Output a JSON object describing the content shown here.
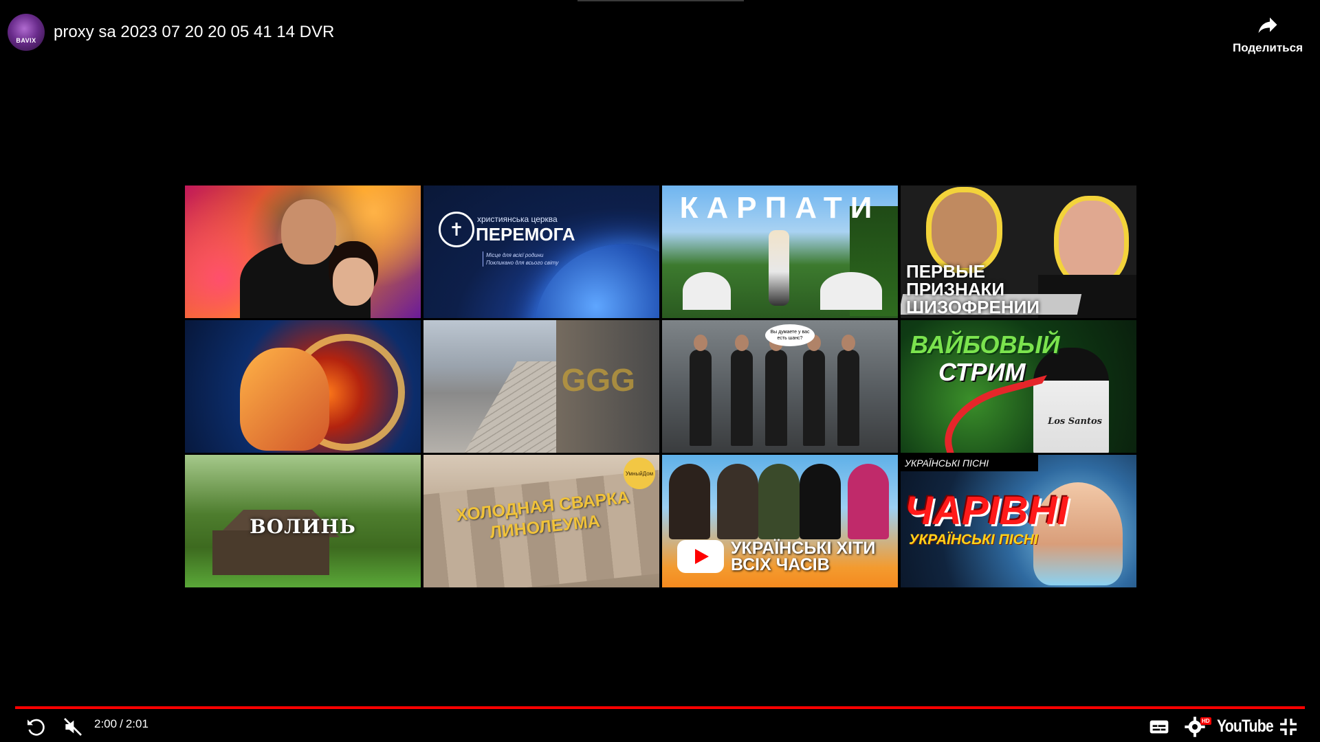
{
  "header": {
    "channel_avatar_text": "BAVIX",
    "video_title": "proxy sa 2023 07 20 20 05 41 14 DVR",
    "share_label": "Поделиться"
  },
  "thumbnails": [
    {
      "name": "thumb-action-movie"
    },
    {
      "name": "thumb-peremoga",
      "small": "християнська церква",
      "title": "ПЕРЕМОГА",
      "sub1": "Місце для всієї родини",
      "sub2": "Покликано для всього світу"
    },
    {
      "name": "thumb-karpaty",
      "title": "КАРПАТИ"
    },
    {
      "name": "thumb-schizophrenia",
      "line1": "ПЕРВЫЕ",
      "line2": "ПРИЗНАКИ",
      "line3": "ШИЗОФРЕНИИ"
    },
    {
      "name": "thumb-nautilus-art"
    },
    {
      "name": "thumb-street-walk",
      "watermark": "GGG"
    },
    {
      "name": "thumb-men-cars",
      "bubble": "Вы думаете у вас есть шанс?"
    },
    {
      "name": "thumb-vibe-stream",
      "line1": "ВАЙБОВЫЙ",
      "line2": "СТРИМ",
      "shirt": "Los Santos"
    },
    {
      "name": "thumb-volyn",
      "title": "ВОЛИНЬ"
    },
    {
      "name": "thumb-linoleum",
      "line1": "ХОЛОДНАЯ СВАРКА",
      "line2": "ЛИНОЛЕУМА",
      "logo": "УмныйДом"
    },
    {
      "name": "thumb-ukrainian-hits",
      "line1": "УКРАЇНСЬКІ ХІТИ",
      "line2": "ВСІХ ЧАСІВ"
    },
    {
      "name": "thumb-charivni",
      "header": "УКРАЇНСЬКІ ПІСНІ",
      "title": "ЧАРІВНІ",
      "sub": "УКРАЇНСЬКІ ПІСНІ"
    }
  ],
  "player": {
    "current_time": "2:00",
    "duration": "2:01",
    "time_separator": "/",
    "progress_fraction": 0.99,
    "youtube_label": "YouTube",
    "hd_badge": "HD",
    "accent_color": "#ff0000",
    "icons": [
      "replay-icon",
      "muted-volume-icon",
      "subtitles-icon",
      "settings-icon",
      "youtube-logo",
      "exit-fullscreen-icon"
    ]
  }
}
